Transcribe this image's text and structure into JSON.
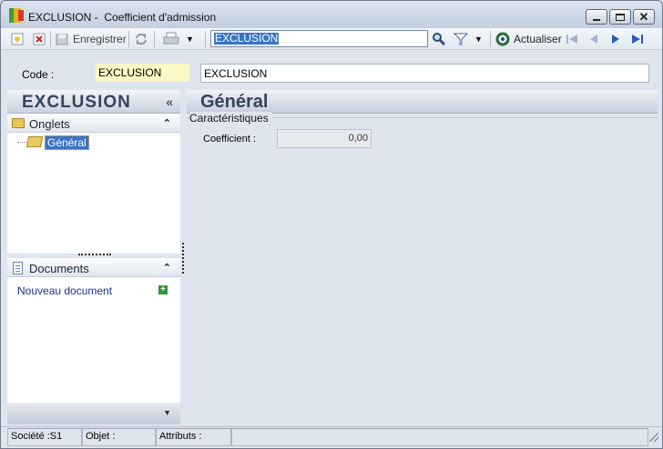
{
  "window": {
    "title": "EXCLUSION -  Coefficient d'admission"
  },
  "toolbar": {
    "save_label": "Enregistrer",
    "search_value": "EXCLUSION",
    "refresh_label": "Actualiser"
  },
  "record": {
    "code_label": "Code :",
    "code_value": "EXCLUSION",
    "libelle_value": "EXCLUSION"
  },
  "sidebar": {
    "title": "EXCLUSION",
    "tabs_section": "Onglets",
    "tabs": [
      {
        "label": "Général",
        "selected": true
      }
    ],
    "documents_section": "Documents",
    "new_document_label": "Nouveau document"
  },
  "main": {
    "section_title": "Général",
    "group_label": "Caractéristiques",
    "coefficient_label": "Coefficient :",
    "coefficient_value": "0,00"
  },
  "statusbar": {
    "societe": "Société :S1",
    "objet": "Objet :",
    "attributs": "Attributs :"
  },
  "colors": {
    "selection": "#3a74c6",
    "code_field_bg": "#fbf8c6",
    "header_title": "#34445a"
  }
}
